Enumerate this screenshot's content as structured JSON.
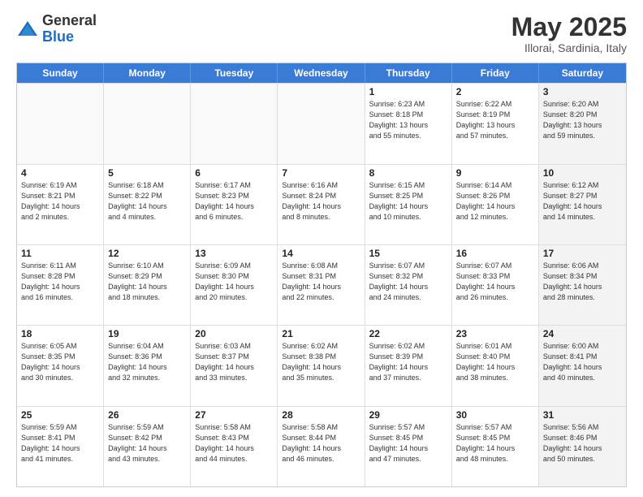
{
  "header": {
    "logo": {
      "general": "General",
      "blue": "Blue"
    },
    "title": "May 2025",
    "location": "Illorai, Sardinia, Italy"
  },
  "calendar": {
    "days_of_week": [
      "Sunday",
      "Monday",
      "Tuesday",
      "Wednesday",
      "Thursday",
      "Friday",
      "Saturday"
    ],
    "weeks": [
      [
        {
          "day": "",
          "info": "",
          "empty": true
        },
        {
          "day": "",
          "info": "",
          "empty": true
        },
        {
          "day": "",
          "info": "",
          "empty": true
        },
        {
          "day": "",
          "info": "",
          "empty": true
        },
        {
          "day": "1",
          "info": "Sunrise: 6:23 AM\nSunset: 8:18 PM\nDaylight: 13 hours\nand 55 minutes."
        },
        {
          "day": "2",
          "info": "Sunrise: 6:22 AM\nSunset: 8:19 PM\nDaylight: 13 hours\nand 57 minutes."
        },
        {
          "day": "3",
          "info": "Sunrise: 6:20 AM\nSunset: 8:20 PM\nDaylight: 13 hours\nand 59 minutes.",
          "shaded": true
        }
      ],
      [
        {
          "day": "4",
          "info": "Sunrise: 6:19 AM\nSunset: 8:21 PM\nDaylight: 14 hours\nand 2 minutes."
        },
        {
          "day": "5",
          "info": "Sunrise: 6:18 AM\nSunset: 8:22 PM\nDaylight: 14 hours\nand 4 minutes."
        },
        {
          "day": "6",
          "info": "Sunrise: 6:17 AM\nSunset: 8:23 PM\nDaylight: 14 hours\nand 6 minutes."
        },
        {
          "day": "7",
          "info": "Sunrise: 6:16 AM\nSunset: 8:24 PM\nDaylight: 14 hours\nand 8 minutes."
        },
        {
          "day": "8",
          "info": "Sunrise: 6:15 AM\nSunset: 8:25 PM\nDaylight: 14 hours\nand 10 minutes."
        },
        {
          "day": "9",
          "info": "Sunrise: 6:14 AM\nSunset: 8:26 PM\nDaylight: 14 hours\nand 12 minutes."
        },
        {
          "day": "10",
          "info": "Sunrise: 6:12 AM\nSunset: 8:27 PM\nDaylight: 14 hours\nand 14 minutes.",
          "shaded": true
        }
      ],
      [
        {
          "day": "11",
          "info": "Sunrise: 6:11 AM\nSunset: 8:28 PM\nDaylight: 14 hours\nand 16 minutes."
        },
        {
          "day": "12",
          "info": "Sunrise: 6:10 AM\nSunset: 8:29 PM\nDaylight: 14 hours\nand 18 minutes."
        },
        {
          "day": "13",
          "info": "Sunrise: 6:09 AM\nSunset: 8:30 PM\nDaylight: 14 hours\nand 20 minutes."
        },
        {
          "day": "14",
          "info": "Sunrise: 6:08 AM\nSunset: 8:31 PM\nDaylight: 14 hours\nand 22 minutes."
        },
        {
          "day": "15",
          "info": "Sunrise: 6:07 AM\nSunset: 8:32 PM\nDaylight: 14 hours\nand 24 minutes."
        },
        {
          "day": "16",
          "info": "Sunrise: 6:07 AM\nSunset: 8:33 PM\nDaylight: 14 hours\nand 26 minutes."
        },
        {
          "day": "17",
          "info": "Sunrise: 6:06 AM\nSunset: 8:34 PM\nDaylight: 14 hours\nand 28 minutes.",
          "shaded": true
        }
      ],
      [
        {
          "day": "18",
          "info": "Sunrise: 6:05 AM\nSunset: 8:35 PM\nDaylight: 14 hours\nand 30 minutes."
        },
        {
          "day": "19",
          "info": "Sunrise: 6:04 AM\nSunset: 8:36 PM\nDaylight: 14 hours\nand 32 minutes."
        },
        {
          "day": "20",
          "info": "Sunrise: 6:03 AM\nSunset: 8:37 PM\nDaylight: 14 hours\nand 33 minutes."
        },
        {
          "day": "21",
          "info": "Sunrise: 6:02 AM\nSunset: 8:38 PM\nDaylight: 14 hours\nand 35 minutes."
        },
        {
          "day": "22",
          "info": "Sunrise: 6:02 AM\nSunset: 8:39 PM\nDaylight: 14 hours\nand 37 minutes."
        },
        {
          "day": "23",
          "info": "Sunrise: 6:01 AM\nSunset: 8:40 PM\nDaylight: 14 hours\nand 38 minutes."
        },
        {
          "day": "24",
          "info": "Sunrise: 6:00 AM\nSunset: 8:41 PM\nDaylight: 14 hours\nand 40 minutes.",
          "shaded": true
        }
      ],
      [
        {
          "day": "25",
          "info": "Sunrise: 5:59 AM\nSunset: 8:41 PM\nDaylight: 14 hours\nand 41 minutes."
        },
        {
          "day": "26",
          "info": "Sunrise: 5:59 AM\nSunset: 8:42 PM\nDaylight: 14 hours\nand 43 minutes."
        },
        {
          "day": "27",
          "info": "Sunrise: 5:58 AM\nSunset: 8:43 PM\nDaylight: 14 hours\nand 44 minutes."
        },
        {
          "day": "28",
          "info": "Sunrise: 5:58 AM\nSunset: 8:44 PM\nDaylight: 14 hours\nand 46 minutes."
        },
        {
          "day": "29",
          "info": "Sunrise: 5:57 AM\nSunset: 8:45 PM\nDaylight: 14 hours\nand 47 minutes."
        },
        {
          "day": "30",
          "info": "Sunrise: 5:57 AM\nSunset: 8:45 PM\nDaylight: 14 hours\nand 48 minutes."
        },
        {
          "day": "31",
          "info": "Sunrise: 5:56 AM\nSunset: 8:46 PM\nDaylight: 14 hours\nand 50 minutes.",
          "shaded": true
        }
      ]
    ]
  }
}
